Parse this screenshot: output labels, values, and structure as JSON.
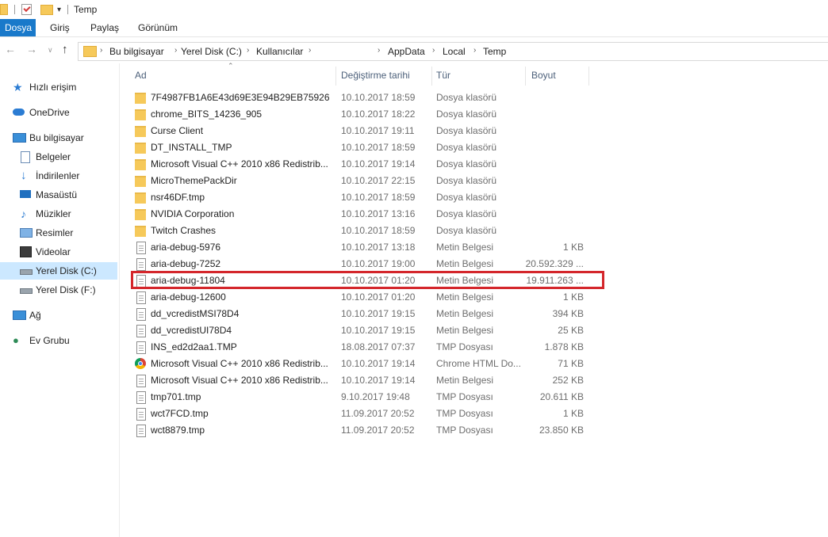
{
  "window": {
    "title": "Temp"
  },
  "ribbon": {
    "tabs": [
      "Dosya",
      "Giriş",
      "Paylaş",
      "Görünüm"
    ]
  },
  "address": {
    "crumbs": [
      "Bu bilgisayar",
      "Yerel Disk (C:)",
      "Kullanıcılar",
      "AppData",
      "Local",
      "Temp"
    ]
  },
  "nav": {
    "items": [
      {
        "label": "Hızlı erişim",
        "icon": "star-icon"
      },
      {
        "label": "OneDrive",
        "icon": "cloud-icon"
      },
      {
        "label": "Bu bilgisayar",
        "icon": "computer-icon"
      },
      {
        "label": "Belgeler",
        "icon": "documents-icon"
      },
      {
        "label": "İndirilenler",
        "icon": "download-icon"
      },
      {
        "label": "Masaüstü",
        "icon": "desktop-icon"
      },
      {
        "label": "Müzikler",
        "icon": "music-icon"
      },
      {
        "label": "Resimler",
        "icon": "pictures-icon"
      },
      {
        "label": "Videolar",
        "icon": "videos-icon"
      },
      {
        "label": "Yerel Disk (C:)",
        "icon": "drive-icon"
      },
      {
        "label": "Yerel Disk (F:)",
        "icon": "drive-icon"
      },
      {
        "label": "Ağ",
        "icon": "network-icon"
      },
      {
        "label": "Ev Grubu",
        "icon": "homegroup-icon"
      }
    ],
    "selected": "Yerel Disk (C:)"
  },
  "list": {
    "columns": [
      "Ad",
      "Değiştirme tarihi",
      "Tür",
      "Boyut"
    ],
    "rows": [
      {
        "name": "7F4987FB1A6E43d69E3E94B29EB75926",
        "date": "10.10.2017 18:59",
        "type": "Dosya klasörü",
        "size": "",
        "icon": "folder"
      },
      {
        "name": "chrome_BITS_14236_905",
        "date": "10.10.2017 18:22",
        "type": "Dosya klasörü",
        "size": "",
        "icon": "folder"
      },
      {
        "name": "Curse Client",
        "date": "10.10.2017 19:11",
        "type": "Dosya klasörü",
        "size": "",
        "icon": "folder"
      },
      {
        "name": "DT_INSTALL_TMP",
        "date": "10.10.2017 18:59",
        "type": "Dosya klasörü",
        "size": "",
        "icon": "folder"
      },
      {
        "name": "Microsoft Visual C++ 2010  x86 Redistrib...",
        "date": "10.10.2017 19:14",
        "type": "Dosya klasörü",
        "size": "",
        "icon": "folder"
      },
      {
        "name": "MicroThemePackDir",
        "date": "10.10.2017 22:15",
        "type": "Dosya klasörü",
        "size": "",
        "icon": "folder"
      },
      {
        "name": "nsr46DF.tmp",
        "date": "10.10.2017 18:59",
        "type": "Dosya klasörü",
        "size": "",
        "icon": "folder"
      },
      {
        "name": "NVIDIA Corporation",
        "date": "10.10.2017 13:16",
        "type": "Dosya klasörü",
        "size": "",
        "icon": "folder"
      },
      {
        "name": "Twitch Crashes",
        "date": "10.10.2017 18:59",
        "type": "Dosya klasörü",
        "size": "",
        "icon": "folder"
      },
      {
        "name": "aria-debug-5976",
        "date": "10.10.2017 13:18",
        "type": "Metin Belgesi",
        "size": "1 KB",
        "icon": "doc"
      },
      {
        "name": "aria-debug-7252",
        "date": "10.10.2017 19:00",
        "type": "Metin Belgesi",
        "size": "20.592.329 ...",
        "icon": "doc"
      },
      {
        "name": "aria-debug-11804",
        "date": "10.10.2017 01:20",
        "type": "Metin Belgesi",
        "size": "19.911.263 ...",
        "icon": "doc"
      },
      {
        "name": "aria-debug-12600",
        "date": "10.10.2017 01:20",
        "type": "Metin Belgesi",
        "size": "1 KB",
        "icon": "doc"
      },
      {
        "name": "dd_vcredistMSI78D4",
        "date": "10.10.2017 19:15",
        "type": "Metin Belgesi",
        "size": "394 KB",
        "icon": "doc"
      },
      {
        "name": "dd_vcredistUI78D4",
        "date": "10.10.2017 19:15",
        "type": "Metin Belgesi",
        "size": "25 KB",
        "icon": "doc"
      },
      {
        "name": "INS_ed2d2aa1.TMP",
        "date": "18.08.2017 07:37",
        "type": "TMP Dosyası",
        "size": "1.878 KB",
        "icon": "doc"
      },
      {
        "name": "Microsoft Visual C++ 2010  x86 Redistrib...",
        "date": "10.10.2017 19:14",
        "type": "Chrome HTML Do...",
        "size": "71 KB",
        "icon": "chrome"
      },
      {
        "name": "Microsoft Visual C++ 2010  x86 Redistrib...",
        "date": "10.10.2017 19:14",
        "type": "Metin Belgesi",
        "size": "252 KB",
        "icon": "doc"
      },
      {
        "name": "tmp701.tmp",
        "date": "9.10.2017 19:48",
        "type": "TMP Dosyası",
        "size": "20.611 KB",
        "icon": "doc"
      },
      {
        "name": "wct7FCD.tmp",
        "date": "11.09.2017 20:52",
        "type": "TMP Dosyası",
        "size": "1 KB",
        "icon": "doc"
      },
      {
        "name": "wct8879.tmp",
        "date": "11.09.2017 20:52",
        "type": "TMP Dosyası",
        "size": "23.850 KB",
        "icon": "doc"
      }
    ]
  }
}
